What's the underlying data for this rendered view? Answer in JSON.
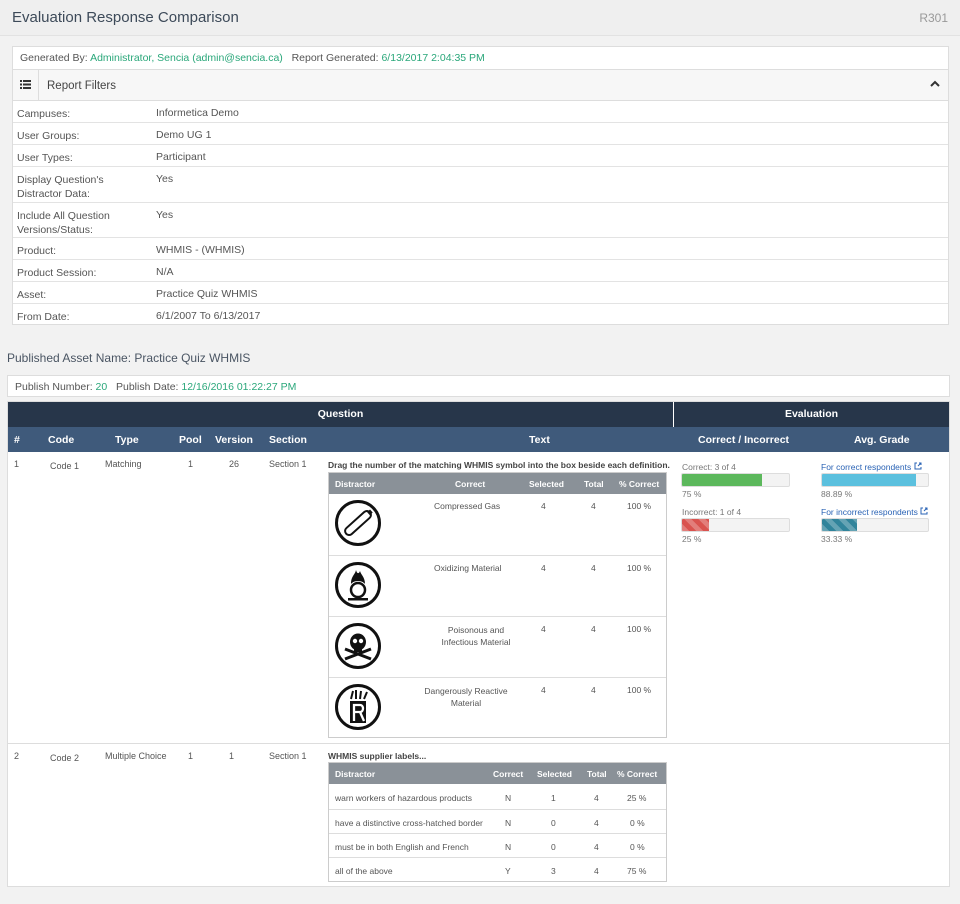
{
  "header": {
    "title": "Evaluation Response Comparison",
    "report_code": "R301"
  },
  "generated": {
    "by_label": "Generated By:",
    "by_value": "Administrator, Sencia (admin@sencia.ca)",
    "date_label": "Report Generated:",
    "date_value": "6/13/2017 2:04:35 PM"
  },
  "filters": {
    "title": "Report Filters",
    "rows": [
      {
        "label": "Campuses:",
        "value": "Informetica Demo"
      },
      {
        "label": "User Groups:",
        "value": "Demo UG 1"
      },
      {
        "label": "User Types:",
        "value": "Participant"
      },
      {
        "label": "Display Question's Distractor Data:",
        "value": "Yes"
      },
      {
        "label": "Include All Question Versions/Status:",
        "value": "Yes"
      },
      {
        "label": "Product:",
        "value": "WHMIS - (WHMIS)"
      },
      {
        "label": "Product Session:",
        "value": "N/A"
      },
      {
        "label": "Asset:",
        "value": "Practice Quiz WHMIS"
      },
      {
        "label": "From Date:",
        "value": "6/1/2007 To 6/13/2017"
      }
    ]
  },
  "asset": {
    "published_name": "Published Asset Name: Practice Quiz WHMIS",
    "publish_number_label": "Publish Number:",
    "publish_number": "20",
    "publish_date_label": "Publish Date:",
    "publish_date": "12/16/2016 01:22:27 PM"
  },
  "table": {
    "group_headers": {
      "question": "Question",
      "evaluation": "Evaluation"
    },
    "columns": [
      "#",
      "Code",
      "Type",
      "Pool",
      "Version",
      "Section",
      "Text",
      "Correct / Incorrect",
      "Avg. Grade"
    ],
    "rows": [
      {
        "num": "1",
        "code": "Code 1",
        "type": "Matching",
        "pool": "1",
        "version": "26",
        "section": "Section 1",
        "text": "Drag the number of the matching WHMIS symbol into the box beside each definition.",
        "distractor_columns": [
          "Distractor",
          "Correct",
          "Selected",
          "Total",
          "% Correct"
        ],
        "distractors": [
          {
            "symbol": "compressed-gas-icon",
            "correct": "Compressed Gas",
            "selected": "4",
            "total": "4",
            "pct": "100 %"
          },
          {
            "symbol": "oxidizing-material-icon",
            "correct": "Oxidizing Material",
            "selected": "4",
            "total": "4",
            "pct": "100 %"
          },
          {
            "symbol": "poisonous-infectious-icon",
            "correct": "Poisonous and Infectious Material",
            "selected": "4",
            "total": "4",
            "pct": "100 %"
          },
          {
            "symbol": "dangerously-reactive-icon",
            "correct": "Dangerously Reactive Material",
            "selected": "4",
            "total": "4",
            "pct": "100 %"
          }
        ],
        "evaluation": {
          "correct_label": "Correct: 3 of 4",
          "correct_pct": "75 %",
          "correct_fraction": 0.75,
          "incorrect_label": "Incorrect: 1 of 4",
          "incorrect_pct": "25 %",
          "incorrect_fraction": 0.25,
          "avg_correct_link": "For correct respondents",
          "avg_correct_pct": "88.89 %",
          "avg_correct_fraction": 0.8889,
          "avg_incorrect_link": "For incorrect respondents",
          "avg_incorrect_pct": "33.33 %",
          "avg_incorrect_fraction": 0.3333
        }
      },
      {
        "num": "2",
        "code": "Code 2",
        "type": "Multiple Choice",
        "pool": "1",
        "version": "1",
        "section": "Section 1",
        "text": "WHMIS supplier labels...",
        "distractor_columns": [
          "Distractor",
          "Correct",
          "Selected",
          "Total",
          "% Correct"
        ],
        "distractors": [
          {
            "text": "warn workers of hazardous products",
            "correct": "N",
            "selected": "1",
            "total": "4",
            "pct": "25 %"
          },
          {
            "text": "have a distinctive cross-hatched border",
            "correct": "N",
            "selected": "0",
            "total": "4",
            "pct": "0 %"
          },
          {
            "text": "must be in both English and French",
            "correct": "N",
            "selected": "0",
            "total": "4",
            "pct": "0 %"
          },
          {
            "text": "all of the above",
            "correct": "Y",
            "selected": "3",
            "total": "4",
            "pct": "75 %"
          }
        ]
      }
    ]
  },
  "colors": {
    "accent_green": "#2aa77a",
    "header_dark": "#27364a",
    "header_mid": "#3f5a7b",
    "link_blue": "#2a63b5"
  }
}
